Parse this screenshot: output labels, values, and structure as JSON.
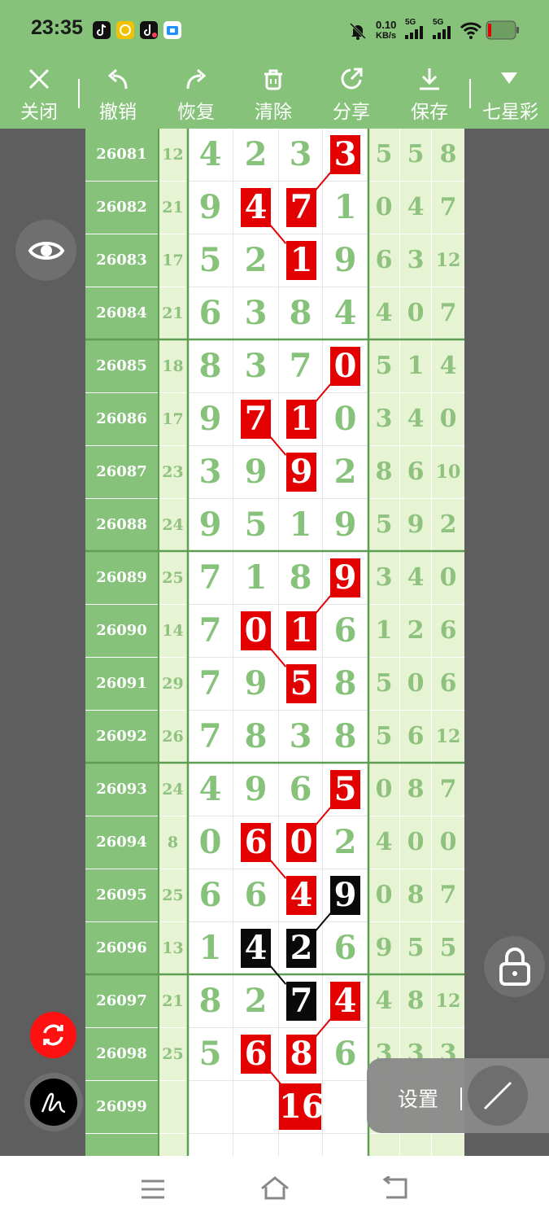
{
  "status_bar": {
    "time": "23:35",
    "net_speed_value": "0.10",
    "net_speed_unit": "KB/s",
    "sim1": "5G",
    "sim2": "5G"
  },
  "toolbar": {
    "close": "关闭",
    "undo": "撤销",
    "redo": "恢复",
    "clear": "清除",
    "share": "分享",
    "save": "保存",
    "lottery": "七星彩"
  },
  "rows": [
    {
      "issue": "26081",
      "sum": "12",
      "digits": [
        "4",
        "2",
        "3",
        "3"
      ],
      "tail": [
        "5",
        "5",
        "8"
      ]
    },
    {
      "issue": "26082",
      "sum": "21",
      "digits": [
        "9",
        "4",
        "7",
        "1"
      ],
      "tail": [
        "0",
        "4",
        "7"
      ]
    },
    {
      "issue": "26083",
      "sum": "17",
      "digits": [
        "5",
        "2",
        "1",
        "9"
      ],
      "tail": [
        "6",
        "3",
        "12"
      ]
    },
    {
      "issue": "26084",
      "sum": "21",
      "digits": [
        "6",
        "3",
        "8",
        "4"
      ],
      "tail": [
        "4",
        "0",
        "7"
      ]
    },
    {
      "issue": "26085",
      "sum": "18",
      "digits": [
        "8",
        "3",
        "7",
        "0"
      ],
      "tail": [
        "5",
        "1",
        "4"
      ]
    },
    {
      "issue": "26086",
      "sum": "17",
      "digits": [
        "9",
        "7",
        "1",
        "0"
      ],
      "tail": [
        "3",
        "4",
        "0"
      ]
    },
    {
      "issue": "26087",
      "sum": "23",
      "digits": [
        "3",
        "9",
        "9",
        "2"
      ],
      "tail": [
        "8",
        "6",
        "10"
      ]
    },
    {
      "issue": "26088",
      "sum": "24",
      "digits": [
        "9",
        "5",
        "1",
        "9"
      ],
      "tail": [
        "5",
        "9",
        "2"
      ]
    },
    {
      "issue": "26089",
      "sum": "25",
      "digits": [
        "7",
        "1",
        "8",
        "9"
      ],
      "tail": [
        "3",
        "4",
        "0"
      ]
    },
    {
      "issue": "26090",
      "sum": "14",
      "digits": [
        "7",
        "0",
        "1",
        "6"
      ],
      "tail": [
        "1",
        "2",
        "6"
      ]
    },
    {
      "issue": "26091",
      "sum": "29",
      "digits": [
        "7",
        "9",
        "5",
        "8"
      ],
      "tail": [
        "5",
        "0",
        "6"
      ]
    },
    {
      "issue": "26092",
      "sum": "26",
      "digits": [
        "7",
        "8",
        "3",
        "8"
      ],
      "tail": [
        "5",
        "6",
        "12"
      ]
    },
    {
      "issue": "26093",
      "sum": "24",
      "digits": [
        "4",
        "9",
        "6",
        "5"
      ],
      "tail": [
        "0",
        "8",
        "7"
      ]
    },
    {
      "issue": "26094",
      "sum": "8",
      "digits": [
        "0",
        "6",
        "0",
        "2"
      ],
      "tail": [
        "4",
        "0",
        "0"
      ]
    },
    {
      "issue": "26095",
      "sum": "25",
      "digits": [
        "6",
        "6",
        "4",
        "9"
      ],
      "tail": [
        "0",
        "8",
        "7"
      ]
    },
    {
      "issue": "26096",
      "sum": "13",
      "digits": [
        "1",
        "4",
        "2",
        "6"
      ],
      "tail": [
        "9",
        "5",
        "5"
      ]
    },
    {
      "issue": "26097",
      "sum": "21",
      "digits": [
        "8",
        "2",
        "7",
        "4"
      ],
      "tail": [
        "4",
        "8",
        "12"
      ]
    },
    {
      "issue": "26098",
      "sum": "25",
      "digits": [
        "5",
        "6",
        "8",
        "6"
      ],
      "tail": [
        "3",
        "3",
        "3"
      ]
    },
    {
      "issue": "26099",
      "sum": "",
      "digits": [
        "",
        "",
        "16",
        ""
      ],
      "tail": [
        "",
        "",
        ""
      ]
    }
  ],
  "highlights": [
    {
      "row": 0,
      "col": 3,
      "color": "red"
    },
    {
      "row": 1,
      "col": 1,
      "color": "red"
    },
    {
      "row": 1,
      "col": 2,
      "color": "red"
    },
    {
      "row": 2,
      "col": 2,
      "color": "red"
    },
    {
      "row": 4,
      "col": 3,
      "color": "red"
    },
    {
      "row": 5,
      "col": 1,
      "color": "red"
    },
    {
      "row": 5,
      "col": 2,
      "color": "red"
    },
    {
      "row": 6,
      "col": 2,
      "color": "red"
    },
    {
      "row": 8,
      "col": 3,
      "color": "red"
    },
    {
      "row": 9,
      "col": 1,
      "color": "red"
    },
    {
      "row": 9,
      "col": 2,
      "color": "red"
    },
    {
      "row": 10,
      "col": 2,
      "color": "red"
    },
    {
      "row": 12,
      "col": 3,
      "color": "red"
    },
    {
      "row": 13,
      "col": 1,
      "color": "red"
    },
    {
      "row": 13,
      "col": 2,
      "color": "red"
    },
    {
      "row": 14,
      "col": 2,
      "color": "red"
    },
    {
      "row": 14,
      "col": 3,
      "color": "black"
    },
    {
      "row": 15,
      "col": 1,
      "color": "black"
    },
    {
      "row": 15,
      "col": 2,
      "color": "black"
    },
    {
      "row": 16,
      "col": 2,
      "color": "black"
    },
    {
      "row": 16,
      "col": 3,
      "color": "red"
    },
    {
      "row": 17,
      "col": 1,
      "color": "red"
    },
    {
      "row": 17,
      "col": 2,
      "color": "red"
    },
    {
      "row": 18,
      "col": 2,
      "color": "red"
    }
  ],
  "connectors": [
    {
      "from": [
        0,
        3
      ],
      "to": [
        1,
        2
      ],
      "color": "red"
    },
    {
      "from": [
        1,
        1
      ],
      "to": [
        2,
        2
      ],
      "color": "red"
    },
    {
      "from": [
        4,
        3
      ],
      "to": [
        5,
        2
      ],
      "color": "red"
    },
    {
      "from": [
        5,
        1
      ],
      "to": [
        6,
        2
      ],
      "color": "red"
    },
    {
      "from": [
        8,
        3
      ],
      "to": [
        9,
        2
      ],
      "color": "red"
    },
    {
      "from": [
        9,
        1
      ],
      "to": [
        10,
        2
      ],
      "color": "red"
    },
    {
      "from": [
        12,
        3
      ],
      "to": [
        13,
        2
      ],
      "color": "red"
    },
    {
      "from": [
        13,
        1
      ],
      "to": [
        14,
        2
      ],
      "color": "red"
    },
    {
      "from": [
        14,
        3
      ],
      "to": [
        15,
        2
      ],
      "color": "black"
    },
    {
      "from": [
        15,
        1
      ],
      "to": [
        16,
        2
      ],
      "color": "black"
    },
    {
      "from": [
        16,
        3
      ],
      "to": [
        17,
        2
      ],
      "color": "red"
    },
    {
      "from": [
        17,
        1
      ],
      "to": [
        18,
        2
      ],
      "color": "red"
    }
  ],
  "settings_panel": {
    "label": "设置"
  },
  "colors": {
    "accent": "#86c27a",
    "highlight_red": "#e30000",
    "highlight_black": "#0a0a0a",
    "panel_bg": "#5e5e5e"
  },
  "icons": {
    "eye": "eye-icon",
    "lock": "lock-icon",
    "refresh": "refresh-icon",
    "pen": "pen-icon",
    "line": "line-tool-icon",
    "menu": "menu-icon",
    "home": "home-icon",
    "back": "back-icon"
  }
}
